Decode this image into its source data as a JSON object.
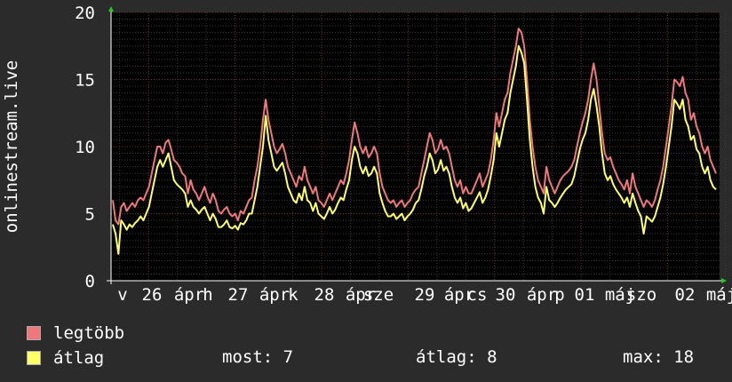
{
  "chart_data": {
    "type": "line",
    "ylabel": "onlinestream.live",
    "ylim": [
      0,
      20
    ],
    "yticks": [
      "0",
      "5",
      "10",
      "15",
      "20"
    ],
    "xlabels": [
      "v",
      "26",
      "ápr",
      "h",
      "27",
      "ápr",
      "k",
      "28",
      "ápr",
      "sze",
      "29",
      "ápr",
      "cs",
      "30",
      "ápr",
      "p",
      "01",
      "máj",
      "szo",
      "02",
      "máj"
    ],
    "grid": true,
    "colors": {
      "legtobb": "#f0787a",
      "atlag": "#ffff66"
    },
    "series": [
      {
        "name": "legtöbb",
        "values": [
          6,
          4.5,
          4.2,
          5.5,
          5.8,
          5.2,
          5.5,
          5.8,
          5.5,
          6,
          6.2,
          6,
          6.5,
          7,
          8,
          9,
          10,
          10,
          9.5,
          10.3,
          10.5,
          9.8,
          9,
          8.8,
          8.5,
          8,
          7.8,
          6.5,
          7.5,
          6.8,
          6.5,
          6,
          6.5,
          7,
          6.3,
          5.8,
          6.5,
          6,
          5.2,
          5,
          5.3,
          5.5,
          5,
          4.8,
          5,
          4.5,
          5.2,
          5,
          5.5,
          6,
          6.2,
          7.5,
          8.5,
          10,
          12,
          13.5,
          12,
          11,
          10,
          9.5,
          9.8,
          10.2,
          9.5,
          8.5,
          8,
          7.5,
          7,
          7.8,
          7.5,
          8.5,
          7.5,
          7,
          6.5,
          7,
          6,
          5.8,
          5.5,
          6,
          6.5,
          6,
          6.5,
          7,
          7.5,
          7.2,
          8,
          9,
          10.5,
          11.8,
          11,
          10,
          9.5,
          10,
          9.2,
          9.5,
          10,
          9.5,
          8,
          7,
          6.5,
          6,
          5.8,
          6,
          5.5,
          5.8,
          6,
          5.5,
          5.8,
          6,
          6.5,
          6.8,
          7,
          8,
          9,
          10,
          11,
          10.5,
          9.5,
          9.8,
          10.5,
          9.8,
          10,
          9.5,
          8.5,
          7.5,
          7,
          7.5,
          6.5,
          7,
          6.5,
          6.5,
          7,
          7.5,
          8,
          7,
          7.5,
          8,
          9,
          10.5,
          12.5,
          11.5,
          12.5,
          13.5,
          14,
          15.5,
          16.5,
          17.5,
          18.8,
          18.5,
          17.5,
          15,
          12,
          10,
          8.5,
          7.5,
          7,
          6.5,
          8.5,
          7.5,
          7,
          6.5,
          7,
          7.5,
          7.8,
          8,
          8.2,
          8.5,
          9,
          10,
          11,
          11.8,
          12.5,
          13.5,
          15,
          16.2,
          15,
          13,
          11,
          9.5,
          9,
          9.2,
          8.5,
          8,
          7.5,
          7.2,
          6.8,
          7.5,
          6.5,
          8,
          7,
          6.5,
          6,
          5.5,
          6,
          5.8,
          5.5,
          6,
          6.8,
          7.5,
          8.5,
          10,
          11.5,
          13,
          15,
          14.8,
          14.5,
          15.2,
          14,
          13.5,
          12,
          12.5,
          11.5,
          11,
          10,
          9.5,
          10,
          9,
          8.5,
          8
        ]
      },
      {
        "name": "átlag",
        "values": [
          4.2,
          3.5,
          2,
          4.5,
          4.2,
          3.8,
          4.2,
          4,
          4.3,
          4.5,
          4.8,
          4.5,
          5,
          5.5,
          6.5,
          7.5,
          8.5,
          9,
          8.5,
          9,
          9.5,
          8.5,
          7.5,
          7.2,
          7,
          6.8,
          6.5,
          5.5,
          6,
          5.5,
          5.3,
          5,
          5.3,
          5.5,
          5,
          4.5,
          5,
          4.6,
          4,
          4,
          4.2,
          4.5,
          4,
          3.9,
          4.1,
          3.8,
          4.3,
          4.2,
          4.5,
          5,
          5,
          6,
          7,
          8.5,
          10,
          12.3,
          10.5,
          9.5,
          8.5,
          8.2,
          8.5,
          8.8,
          8,
          7,
          6.5,
          6,
          5.8,
          6.5,
          6,
          7,
          6,
          5.8,
          5.2,
          5.8,
          5,
          4.8,
          4.6,
          5,
          5.5,
          5,
          5.3,
          5.8,
          6.2,
          6,
          6.8,
          7.5,
          9,
          10,
          9.5,
          8.5,
          8,
          8.5,
          7.8,
          8,
          8.5,
          8,
          6.5,
          5.8,
          5.2,
          4.8,
          4.8,
          5,
          4.6,
          4.8,
          5,
          4.5,
          4.8,
          5,
          5.3,
          5.8,
          6,
          6.8,
          7.8,
          8.5,
          9.5,
          9,
          8,
          8.3,
          9,
          8.2,
          8.5,
          8,
          7,
          6.2,
          5.8,
          6.2,
          5.4,
          5.8,
          5.2,
          5.4,
          5.8,
          6.2,
          6.6,
          5.8,
          6.2,
          6.8,
          7.8,
          9,
          11,
          10,
          11,
          12,
          12.5,
          14,
          15,
          16,
          17.5,
          17,
          16.2,
          13.5,
          10.5,
          8.5,
          7,
          6.2,
          5.8,
          5,
          7,
          6,
          5.8,
          5.5,
          5.8,
          6.2,
          6.5,
          6.8,
          7,
          7.2,
          7.8,
          8.8,
          9.8,
          10.5,
          11,
          12,
          13.5,
          14.3,
          13,
          11.5,
          9.5,
          8,
          7.5,
          7.8,
          7.2,
          6.8,
          6.5,
          6.2,
          5.8,
          6.2,
          5.5,
          6.5,
          5.8,
          5.2,
          4.8,
          3.5,
          4.8,
          4.6,
          4.4,
          4.8,
          5.5,
          6.2,
          7.2,
          8.5,
          10,
          11.5,
          13.5,
          13.2,
          12.8,
          13.5,
          12,
          11.5,
          10.5,
          10.8,
          9.8,
          9.5,
          8.5,
          8,
          8.5,
          7.5,
          7,
          6.8
        ]
      }
    ]
  },
  "legend": {
    "items": [
      {
        "label": "legtöbb",
        "color": "#f0787a"
      },
      {
        "label": "átlag",
        "color": "#ffff66"
      }
    ]
  },
  "stats": {
    "most": "most: 7",
    "atlag": "átlag: 8",
    "max": "max: 18"
  }
}
